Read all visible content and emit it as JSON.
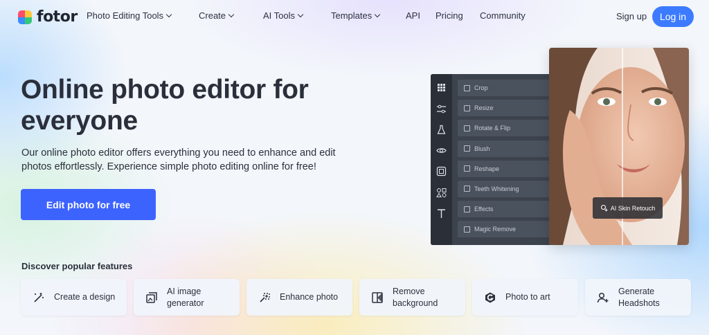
{
  "brand": {
    "name": "fotor"
  },
  "nav": {
    "items": [
      {
        "label": "Photo Editing Tools",
        "has_dropdown": true
      },
      {
        "label": "Create",
        "has_dropdown": true
      },
      {
        "label": "AI Tools",
        "has_dropdown": true
      },
      {
        "label": "Templates",
        "has_dropdown": true
      },
      {
        "label": "API",
        "has_dropdown": false
      },
      {
        "label": "Pricing",
        "has_dropdown": false
      },
      {
        "label": "Community",
        "has_dropdown": false
      }
    ],
    "signup": "Sign up",
    "login": "Log in"
  },
  "hero": {
    "title": "Online photo editor for everyone",
    "description": "Our online photo editor offers everything you need to enhance and edit photos effortlessly. Experience simple photo editing online for free!",
    "cta": "Edit photo for free"
  },
  "features": {
    "title": "Discover popular features",
    "cards": [
      {
        "label": "Create a design",
        "icon": "magic-wand-icon"
      },
      {
        "label": "AI image generator",
        "icon": "image-stack-icon"
      },
      {
        "label": "Enhance photo",
        "icon": "sparkle-wand-icon"
      },
      {
        "label": "Remove background",
        "icon": "cutout-icon"
      },
      {
        "label": "Photo to art",
        "icon": "g-logo-icon"
      },
      {
        "label": "Generate Headshots",
        "icon": "person-plus-icon"
      }
    ]
  },
  "editor": {
    "tools": [
      "Crop",
      "Resize",
      "Rotate & Flip",
      "Blush",
      "Reshape",
      "Teeth Whitening",
      "Effects",
      "Magic Remove"
    ],
    "badge": "AI Skin Retouch"
  },
  "colors": {
    "primary": "#3d63ff",
    "login": "#3c7bff",
    "editor_bg": "#3c434d"
  }
}
